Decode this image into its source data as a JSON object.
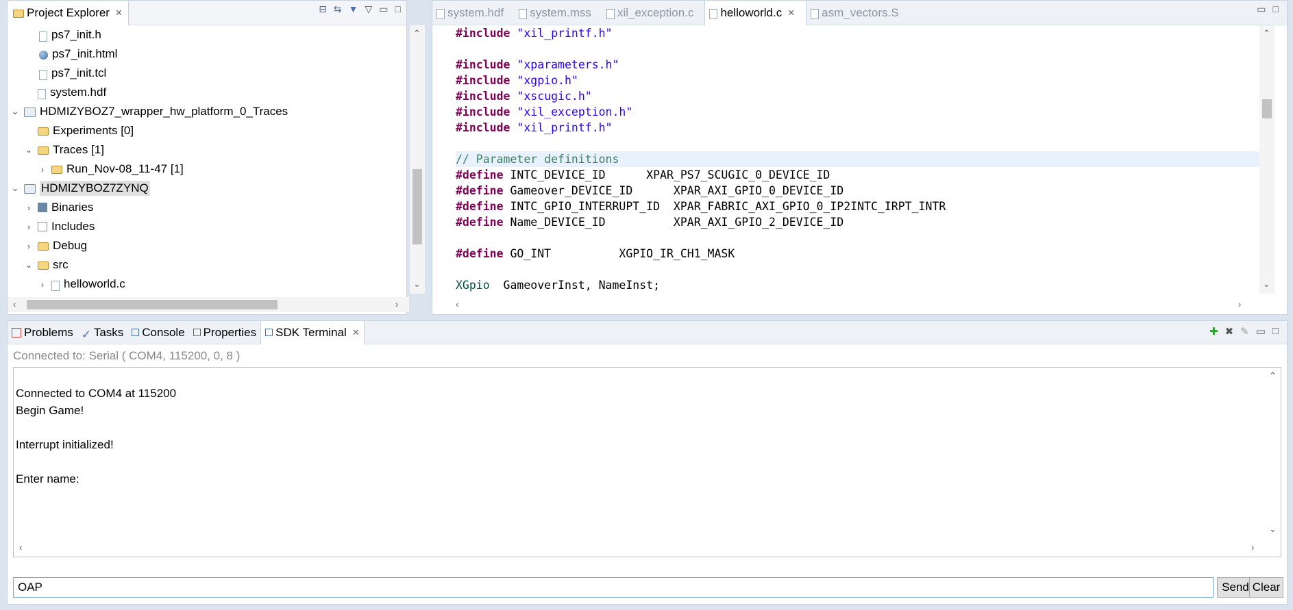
{
  "explorer": {
    "tab_label": "Project Explorer",
    "items": [
      {
        "label": "ps7_init.h",
        "icon": "h-file-icon"
      },
      {
        "label": "ps7_init.html",
        "icon": "html-file-icon"
      },
      {
        "label": "ps7_init.tcl",
        "icon": "file-icon"
      },
      {
        "label": "system.hdf",
        "icon": "hdf-file-icon"
      },
      {
        "label": "HDMIZYBOZ7_wrapper_hw_platform_0_Traces",
        "icon": "project-icon"
      },
      {
        "label": "Experiments [0]",
        "icon": "folder-icon"
      },
      {
        "label": "Traces [1]",
        "icon": "folder-icon"
      },
      {
        "label": "Run_Nov-08_11-47 [1]",
        "icon": "folder-icon"
      },
      {
        "label": "HDMIZYBOZ7ZYNQ",
        "icon": "project-icon"
      },
      {
        "label": "Binaries",
        "icon": "binaries-icon"
      },
      {
        "label": "Includes",
        "icon": "includes-icon"
      },
      {
        "label": "Debug",
        "icon": "folder-icon"
      },
      {
        "label": "src",
        "icon": "folder-icon"
      },
      {
        "label": "helloworld.c",
        "icon": "c-file-icon"
      }
    ]
  },
  "editor": {
    "tabs": [
      {
        "label": "system.hdf"
      },
      {
        "label": "system.mss"
      },
      {
        "label": "xil_exception.c"
      },
      {
        "label": "helloworld.c"
      },
      {
        "label": "asm_vectors.S"
      }
    ],
    "code": {
      "l0_kw": "#include",
      "l0_str": " \"xil_printf.h\"",
      "l2_kw": "#include",
      "l2_str": " \"xparameters.h\"",
      "l3_kw": "#include",
      "l3_str": " \"xgpio.h\"",
      "l4_kw": "#include",
      "l4_str": " \"xscugic.h\"",
      "l5_kw": "#include",
      "l5_str": " \"xil_exception.h\"",
      "l6_kw": "#include",
      "l6_str": " \"xil_printf.h\"",
      "l8_cmt": "// Parameter definitions",
      "l9_kw": "#define",
      "l9_rest": " INTC_DEVICE_ID      XPAR_PS7_SCUGIC_0_DEVICE_ID",
      "l10_kw": "#define",
      "l10_rest": " Gameover_DEVICE_ID      XPAR_AXI_GPIO_0_DEVICE_ID",
      "l11_kw": "#define",
      "l11_rest": " INTC_GPIO_INTERRUPT_ID  XPAR_FABRIC_AXI_GPIO_0_IP2INTC_IRPT_INTR",
      "l12_kw": "#define",
      "l12_rest": " Name_DEVICE_ID          XPAR_AXI_GPIO_2_DEVICE_ID",
      "l14_kw": "#define",
      "l14_rest": " GO_INT          XGPIO_IR_CH1_MASK",
      "l16_typ": "XGpio",
      "l16_rest": "  GameoverInst, NameInst;"
    }
  },
  "bottom": {
    "tabs": [
      {
        "label": "Problems"
      },
      {
        "label": "Tasks"
      },
      {
        "label": "Console"
      },
      {
        "label": "Properties"
      },
      {
        "label": "SDK Terminal"
      }
    ],
    "connection_status": "Connected to: Serial (  COM4, 115200, 0, 8 )",
    "output": [
      "Connected to COM4 at 115200",
      "Begin Game!",
      "Interrupt initialized!",
      "Enter name:"
    ],
    "input_value": "OAP",
    "send_label": "Send",
    "clear_label": "Clear"
  }
}
